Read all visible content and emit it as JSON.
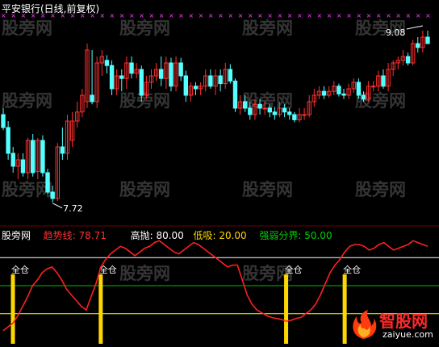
{
  "main_header": {
    "title": "平安银行(日线,前复权)"
  },
  "watermark": {
    "text": "股旁网"
  },
  "ind_header": {
    "name": "股旁网",
    "trend_label": "趋势线:",
    "trend_value": "78.71",
    "high_label": "高抛:",
    "high_value": "80.00",
    "low_label": "低吸:",
    "low_value": "20.00",
    "split_label": "强弱分界:",
    "split_value": "50.00"
  },
  "signal_label": "全仓",
  "logo": {
    "name": "智股网",
    "url": "zaiyue.com"
  },
  "colors": {
    "background": "#000000",
    "up_candle": "#ff3030",
    "down_candle": "#54ffff",
    "trend_line": "#ff2020",
    "high_line": "#ffffff",
    "low_line": "#ffff00",
    "split_line": "#00c000",
    "signal_bar": "#ffd700",
    "cross_marker": "#ff40ff",
    "price_note": "#ffffff"
  },
  "chart_data": [
    {
      "type": "candlestick",
      "title": "平安银行(日线,前复权)",
      "annotations": [
        {
          "label": "7.72",
          "kind": "low"
        },
        {
          "label": "9.08",
          "kind": "high"
        }
      ],
      "ylim": [
        7.6,
        9.15
      ],
      "series": [
        {
          "name": "价格",
          "open": [
            8.4,
            8.3,
            8.1,
            8.0,
            8.05,
            7.95,
            8.2,
            7.96,
            8.2,
            7.95,
            7.8,
            7.75,
            8.15,
            8.1,
            8.2,
            8.35,
            8.42,
            8.5,
            8.55,
            8.5,
            8.8,
            8.82,
            8.78,
            8.6,
            8.7,
            8.68,
            8.8,
            8.72,
            8.75,
            8.55,
            8.65,
            8.7,
            8.75,
            8.68,
            8.8,
            8.62,
            8.8,
            8.7,
            8.55,
            8.62,
            8.6,
            8.62,
            8.7,
            8.62,
            8.7,
            8.64,
            8.75,
            8.66,
            8.45,
            8.5,
            8.45,
            8.4,
            8.48,
            8.45,
            8.45,
            8.42,
            8.4,
            8.45,
            8.42,
            8.4,
            8.36,
            8.4,
            8.4,
            8.5,
            8.55,
            8.58,
            8.55,
            8.58,
            8.62,
            8.56,
            8.55,
            8.6,
            8.65,
            8.55,
            8.52,
            8.62,
            8.62,
            8.7,
            8.62,
            8.75,
            8.8,
            8.82,
            8.85,
            8.8,
            8.95,
            8.92,
            9.0
          ],
          "high": [
            8.45,
            8.35,
            8.15,
            8.1,
            8.1,
            8.22,
            8.25,
            8.22,
            8.24,
            7.98,
            7.85,
            8.18,
            8.3,
            8.4,
            8.42,
            8.5,
            8.6,
            8.95,
            8.9,
            8.85,
            8.9,
            8.86,
            8.82,
            8.75,
            8.75,
            8.85,
            8.85,
            8.8,
            8.78,
            8.7,
            8.75,
            8.8,
            8.85,
            8.85,
            8.84,
            8.85,
            8.84,
            8.74,
            8.65,
            8.65,
            8.65,
            8.75,
            8.75,
            8.75,
            8.75,
            8.8,
            8.79,
            8.68,
            8.55,
            8.55,
            8.5,
            8.52,
            8.52,
            8.5,
            8.48,
            8.46,
            8.5,
            8.48,
            8.45,
            8.42,
            8.45,
            8.45,
            8.55,
            8.6,
            8.62,
            8.62,
            8.62,
            8.66,
            8.64,
            8.6,
            8.64,
            8.68,
            8.68,
            8.58,
            8.66,
            8.66,
            8.74,
            8.75,
            8.8,
            8.82,
            8.85,
            8.9,
            8.88,
            8.98,
            9.0,
            9.05,
            9.05
          ],
          "low": [
            8.28,
            8.05,
            7.95,
            7.9,
            7.92,
            7.9,
            7.92,
            7.9,
            7.92,
            7.78,
            7.72,
            7.73,
            8.05,
            8.05,
            8.15,
            8.3,
            8.38,
            8.45,
            8.48,
            8.45,
            8.7,
            8.72,
            8.55,
            8.55,
            8.58,
            8.6,
            8.68,
            8.68,
            8.5,
            8.52,
            8.6,
            8.66,
            8.62,
            8.6,
            8.58,
            8.58,
            8.66,
            8.5,
            8.5,
            8.55,
            8.55,
            8.58,
            8.6,
            8.55,
            8.58,
            8.6,
            8.64,
            8.42,
            8.4,
            8.42,
            8.36,
            8.36,
            8.4,
            8.4,
            8.38,
            8.36,
            8.38,
            8.38,
            8.36,
            8.34,
            8.34,
            8.36,
            8.38,
            8.46,
            8.52,
            8.52,
            8.53,
            8.55,
            8.54,
            8.52,
            8.52,
            8.57,
            8.52,
            8.5,
            8.5,
            8.58,
            8.58,
            8.6,
            8.58,
            8.7,
            8.75,
            8.78,
            8.78,
            8.78,
            8.88,
            8.88,
            8.95
          ],
          "close": [
            8.3,
            8.1,
            8.0,
            8.05,
            7.95,
            8.2,
            7.95,
            8.2,
            7.95,
            7.8,
            7.75,
            8.15,
            8.1,
            8.35,
            8.35,
            8.42,
            8.55,
            8.9,
            8.5,
            8.8,
            8.85,
            8.78,
            8.6,
            8.7,
            8.68,
            8.8,
            8.72,
            8.75,
            8.55,
            8.65,
            8.7,
            8.75,
            8.68,
            8.8,
            8.62,
            8.8,
            8.7,
            8.55,
            8.62,
            8.6,
            8.62,
            8.7,
            8.62,
            8.7,
            8.64,
            8.75,
            8.66,
            8.45,
            8.5,
            8.45,
            8.4,
            8.48,
            8.45,
            8.45,
            8.42,
            8.4,
            8.45,
            8.42,
            8.4,
            8.36,
            8.4,
            8.4,
            8.5,
            8.55,
            8.58,
            8.55,
            8.58,
            8.62,
            8.56,
            8.55,
            8.6,
            8.65,
            8.55,
            8.52,
            8.62,
            8.62,
            8.7,
            8.62,
            8.75,
            8.8,
            8.82,
            8.85,
            8.8,
            8.95,
            8.92,
            9.0,
            8.95
          ]
        }
      ]
    },
    {
      "type": "line",
      "ylim": [
        0,
        100
      ],
      "reference_lines": [
        {
          "name": "高抛",
          "value": 80
        },
        {
          "name": "强弱分界",
          "value": 50
        },
        {
          "name": "低吸",
          "value": 20
        }
      ],
      "series": [
        {
          "name": "趋势线",
          "values": [
            2,
            6,
            10,
            18,
            28,
            38,
            50,
            56,
            64,
            68,
            70,
            64,
            56,
            46,
            40,
            34,
            28,
            24,
            38,
            52,
            70,
            78,
            84,
            88,
            92,
            90,
            86,
            82,
            86,
            90,
            92,
            96,
            98,
            94,
            90,
            86,
            84,
            88,
            92,
            96,
            94,
            90,
            86,
            82,
            78,
            74,
            70,
            72,
            72,
            56,
            40,
            30,
            24,
            21,
            18,
            16,
            15,
            14,
            12,
            13,
            15,
            16,
            20,
            24,
            30,
            40,
            52,
            64,
            72,
            78,
            86,
            92,
            94,
            94,
            92,
            88,
            90,
            94,
            96,
            92,
            88,
            90,
            92,
            94,
            98,
            96,
            94,
            92
          ]
        }
      ],
      "signals": {
        "label": "全仓",
        "indices": [
          0,
          18,
          56,
          68
        ]
      }
    }
  ]
}
